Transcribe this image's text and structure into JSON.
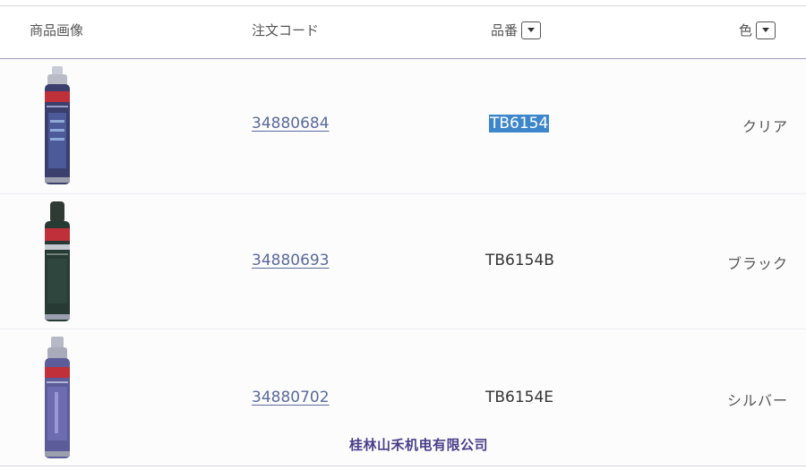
{
  "header": {
    "image_label": "商品画像",
    "code_label": "注文コード",
    "part_label": "品番",
    "color_label": "色"
  },
  "rows": [
    {
      "order_code": "34880684",
      "part_number": "TB6154",
      "color": "クリア",
      "cap_color": "#b9bcc6",
      "body_color": "#3a3f6e"
    },
    {
      "order_code": "34880693",
      "part_number": "TB6154B",
      "color": "ブラック",
      "cap_color": "#2e3a33",
      "body_color": "#273a34"
    },
    {
      "order_code": "34880702",
      "part_number": "TB6154E",
      "color": "シルバー",
      "cap_color": "#a9abbb",
      "body_color": "#5d5c9a"
    }
  ],
  "watermark": "桂林山禾机电有限公司"
}
